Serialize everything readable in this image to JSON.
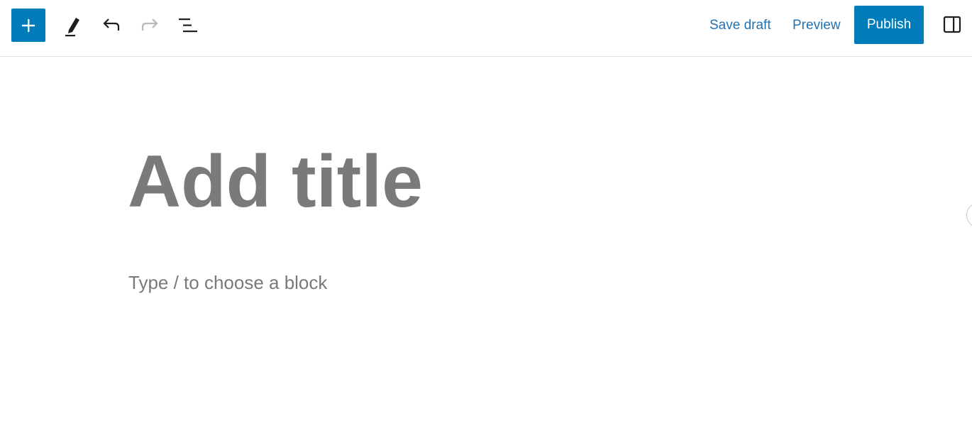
{
  "toolbar": {
    "inserter_icon": "plus-icon",
    "tools_icon": "pencil-icon",
    "undo_icon": "undo-icon",
    "redo_icon": "redo-icon",
    "list_view_icon": "list-view-icon",
    "save_draft_label": "Save draft",
    "preview_label": "Preview",
    "publish_label": "Publish",
    "settings_icon": "sidebar-toggle-icon"
  },
  "editor": {
    "title_placeholder": "Add title",
    "block_placeholder": "Type / to choose a block"
  },
  "colors": {
    "accent": "#007cba",
    "link": "#2271b1",
    "placeholder": "#7a7a7a",
    "redo_disabled": "#b8b8b8"
  }
}
